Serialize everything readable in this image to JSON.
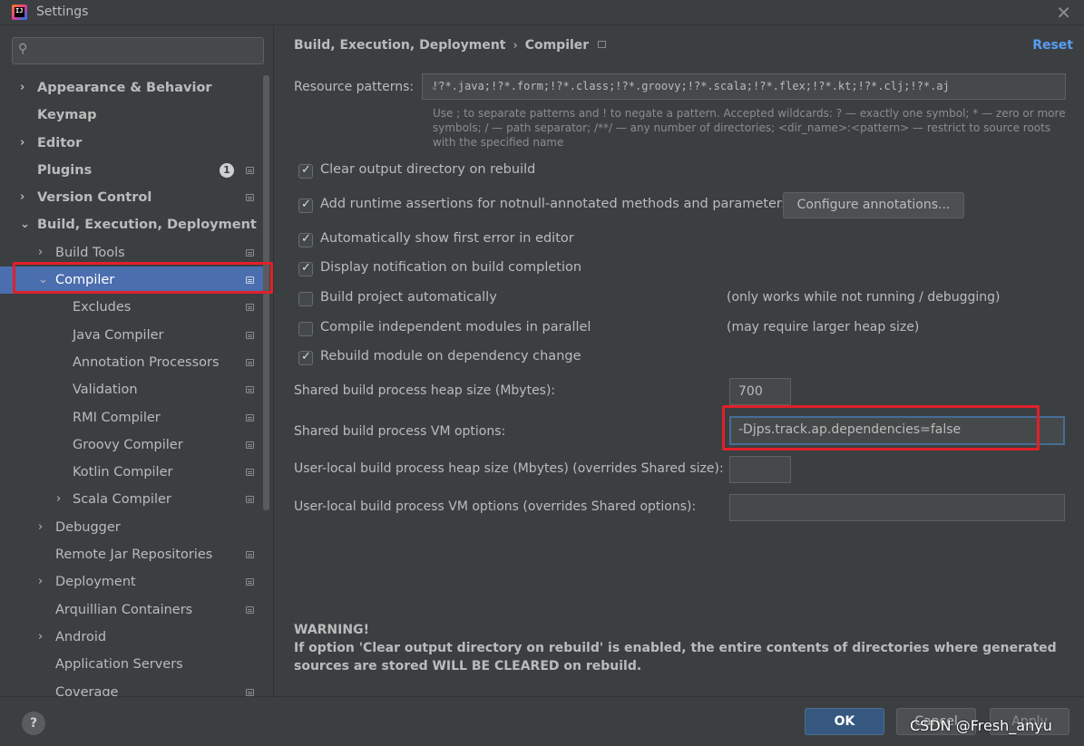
{
  "window": {
    "title": "Settings",
    "close_glyph": "✕",
    "app_icon": "intellij-idea-icon"
  },
  "search": {
    "placeholder": "",
    "value": ""
  },
  "sidebar": {
    "items": [
      {
        "label": "Appearance & Behavior",
        "bold": true,
        "chevron": "›",
        "expanded": false,
        "proj": false
      },
      {
        "label": "Keymap",
        "bold": true,
        "chevron": "",
        "proj": false
      },
      {
        "label": "Editor",
        "bold": true,
        "chevron": "›",
        "expanded": false,
        "proj": false
      },
      {
        "label": "Plugins",
        "bold": true,
        "chevron": "",
        "proj": true,
        "badge": "1"
      },
      {
        "label": "Version Control",
        "bold": true,
        "chevron": "›",
        "expanded": false,
        "proj": true
      },
      {
        "label": "Build, Execution, Deployment",
        "bold": true,
        "chevron": "⌄",
        "expanded": true,
        "proj": false
      },
      {
        "label": "Build Tools",
        "bold": false,
        "chevron": "›",
        "expanded": false,
        "proj": true
      },
      {
        "label": "Compiler",
        "bold": false,
        "chevron": "⌄",
        "expanded": true,
        "proj": true,
        "selected": true
      },
      {
        "label": "Excludes",
        "bold": false,
        "chevron": "",
        "proj": true
      },
      {
        "label": "Java Compiler",
        "bold": false,
        "chevron": "",
        "proj": true
      },
      {
        "label": "Annotation Processors",
        "bold": false,
        "chevron": "",
        "proj": true
      },
      {
        "label": "Validation",
        "bold": false,
        "chevron": "",
        "proj": true
      },
      {
        "label": "RMI Compiler",
        "bold": false,
        "chevron": "",
        "proj": true
      },
      {
        "label": "Groovy Compiler",
        "bold": false,
        "chevron": "",
        "proj": true
      },
      {
        "label": "Kotlin Compiler",
        "bold": false,
        "chevron": "",
        "proj": true
      },
      {
        "label": "Scala Compiler",
        "bold": false,
        "chevron": "›",
        "expanded": false,
        "proj": true
      },
      {
        "label": "Debugger",
        "bold": false,
        "chevron": "›",
        "expanded": false,
        "proj": false
      },
      {
        "label": "Remote Jar Repositories",
        "bold": false,
        "chevron": "",
        "proj": true
      },
      {
        "label": "Deployment",
        "bold": false,
        "chevron": "›",
        "expanded": false,
        "proj": true
      },
      {
        "label": "Arquillian Containers",
        "bold": false,
        "chevron": "",
        "proj": true
      },
      {
        "label": "Android",
        "bold": false,
        "chevron": "›",
        "expanded": false,
        "proj": false
      },
      {
        "label": "Application Servers",
        "bold": false,
        "chevron": "",
        "proj": false
      },
      {
        "label": "Coverage",
        "bold": false,
        "chevron": "",
        "proj": true
      }
    ]
  },
  "breadcrumb": {
    "parent": "Build, Execution, Deployment",
    "separator": "›",
    "current": "Compiler"
  },
  "reset_label": "Reset",
  "resource_patterns": {
    "label": "Resource patterns:",
    "value": "!?*.java;!?*.form;!?*.class;!?*.groovy;!?*.scala;!?*.flex;!?*.kt;!?*.clj;!?*.aj",
    "help": "Use ; to separate patterns and ! to negate a pattern. Accepted wildcards: ? — exactly one symbol; * — zero or more symbols; / — path separator; /**/ — any number of directories; <dir_name>:<pattern> — restrict to source roots with the specified name"
  },
  "options": {
    "clear_output": {
      "label": "Clear output directory on rebuild",
      "checked": true
    },
    "runtime_assertions": {
      "label": "Add runtime assertions for notnull-annotated methods and parameters",
      "checked": true
    },
    "configure_annotations": "Configure annotations...",
    "show_first_error": {
      "label": "Automatically show first error in editor",
      "checked": true
    },
    "notify_build": {
      "label": "Display notification on build completion",
      "checked": true
    },
    "build_auto": {
      "label": "Build project automatically",
      "checked": false,
      "hint": "(only works while not running / debugging)"
    },
    "parallel": {
      "label": "Compile independent modules in parallel",
      "checked": false,
      "hint": "(may require larger heap size)"
    },
    "rebuild_dep": {
      "label": "Rebuild module on dependency change",
      "checked": true
    }
  },
  "fields": {
    "shared_heap": {
      "label": "Shared build process heap size (Mbytes):",
      "value": "700"
    },
    "shared_vm": {
      "label": "Shared build process VM options:",
      "value": "-Djps.track.ap.dependencies=false"
    },
    "local_heap": {
      "label": "User-local build process heap size (Mbytes) (overrides Shared size):",
      "value": ""
    },
    "local_vm": {
      "label": "User-local build process VM options (overrides Shared options):",
      "value": ""
    }
  },
  "warning": {
    "title": "WARNING!",
    "body": "If option 'Clear output directory on rebuild' is enabled, the entire contents of directories where generated sources are stored WILL BE CLEARED on rebuild."
  },
  "footer": {
    "help": "?",
    "ok": "OK",
    "cancel": "Cancel",
    "apply": "Apply",
    "watermark": "CSDN @Fresh_anyu"
  },
  "colors": {
    "selection": "#4b6eaf",
    "link": "#589df6",
    "highlight_box": "#e0202a",
    "ok_button": "#365880"
  }
}
